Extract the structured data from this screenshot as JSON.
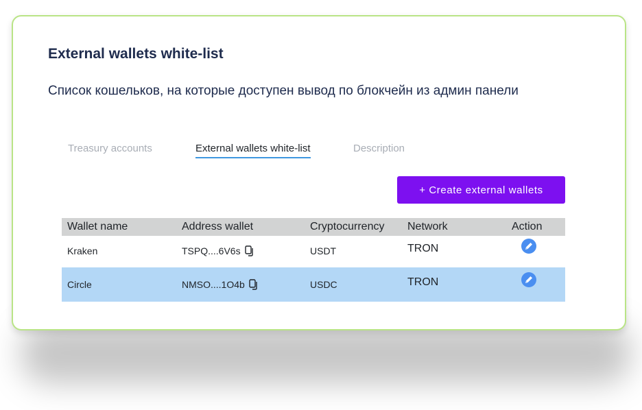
{
  "header": {
    "title": "External wallets white-list",
    "subtitle": "Список кошельков, на которые доступен вывод по блокчейн из админ панели"
  },
  "tabs": [
    {
      "label": "Treasury accounts",
      "active": false
    },
    {
      "label": "External wallets white-list",
      "active": true
    },
    {
      "label": "Description",
      "active": false
    }
  ],
  "actions": {
    "create_label": "+ Create external wallets"
  },
  "table": {
    "columns": [
      "Wallet name",
      "Address wallet",
      "Cryptocurrency",
      "Network",
      "Action"
    ],
    "rows": [
      {
        "name": "Kraken",
        "address": "TSPQ....6V6s",
        "crypto": "USDT",
        "network": "TRON",
        "selected": false
      },
      {
        "name": "Circle",
        "address": "NMSO....1O4b",
        "crypto": "USDC",
        "network": "TRON",
        "selected": true
      }
    ]
  },
  "icons": {
    "copy": "copy-icon",
    "edit": "pencil-icon"
  },
  "colors": {
    "accent": "#7d10f0",
    "tab_underline": "#3e97e0",
    "selected_row": "#b3d7f6",
    "header_row": "#d2d3d3",
    "edit_icon_bg": "#4a8ef0",
    "card_border": "#b9e486"
  }
}
